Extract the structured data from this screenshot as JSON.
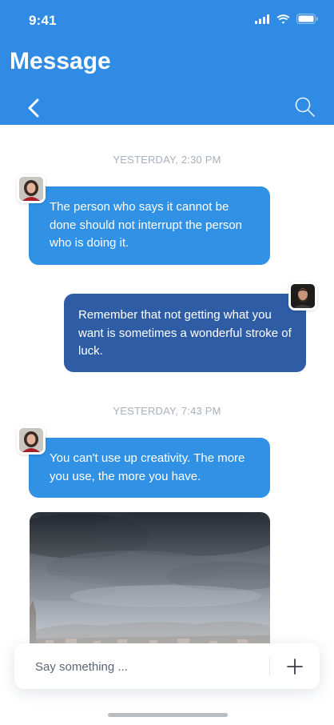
{
  "status_bar": {
    "time": "9:41"
  },
  "header": {
    "title": "Message"
  },
  "conversation": {
    "timestamp_1": "YESTERDAY, 2:30 PM",
    "message_1": "The person who says it cannot be done should not interrupt the person who is doing it.",
    "message_2": "Remember that not getting what you want is sometimes a wonderful stroke of luck.",
    "timestamp_2": "YESTERDAY, 7:43 PM",
    "message_3": "You can't use up creativity. The more you use, the more you have."
  },
  "composer": {
    "placeholder": "Say something ..."
  },
  "colors": {
    "header_bg": "#2f8be3",
    "incoming_bubble": "#3191e5",
    "outgoing_bubble": "#2f5da5",
    "timestamp": "#a7b0bd"
  },
  "icons": {
    "back": "chevron-left-icon",
    "search": "search-icon",
    "add": "plus-icon"
  }
}
